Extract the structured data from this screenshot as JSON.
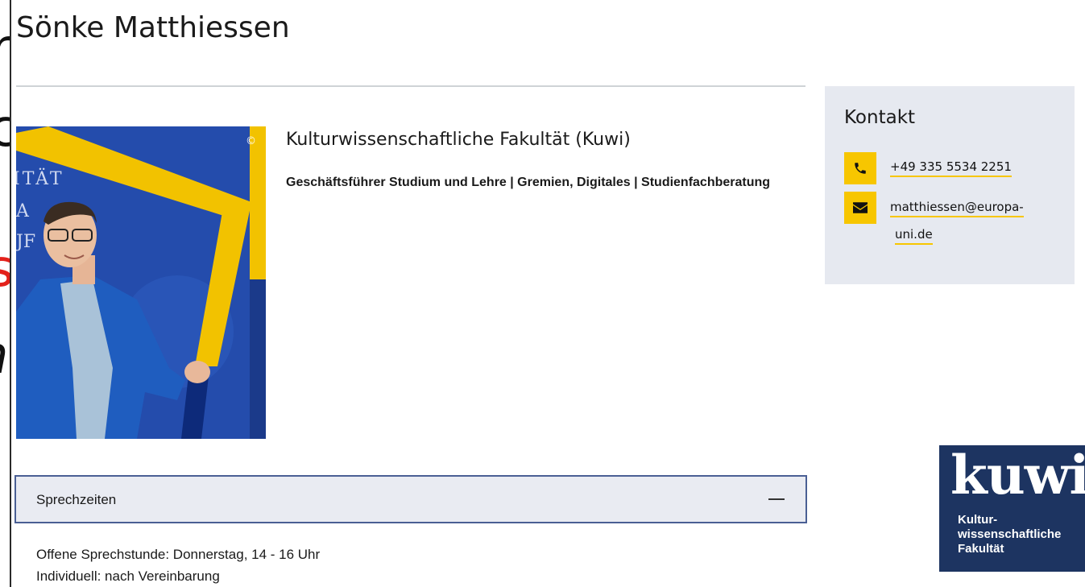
{
  "person": {
    "name": "Sönke Matthiessen",
    "faculty": "Kulturwissenschaftliche Fakultät (Kuwi)",
    "role": "Geschäftsführer Studium und Lehre | Gremien, Digitales | Studienfachberatung"
  },
  "photo": {
    "copyright": "©",
    "banner_lines": [
      "ITÄT",
      "A",
      "JF"
    ]
  },
  "contact": {
    "title": "Kontakt",
    "phone": "+49 335 5534 2251",
    "email_line1": "matthiessen@europa-",
    "email_line2": "uni.de",
    "phone_icon": "phone-icon",
    "email_icon": "envelope-icon"
  },
  "office_hours": {
    "title": "Sprechzeiten",
    "lines": [
      "Offene Sprechstunde: Donnerstag, 14 - 16 Uhr",
      "Individuell: nach Vereinbarung"
    ]
  },
  "logo": {
    "word": "kuwi",
    "lines": [
      "Kultur-",
      "wissenschaftliche",
      "Fakultät"
    ]
  },
  "colors": {
    "accent_yellow": "#f7c600",
    "panel_bg": "#e6e9f0",
    "accordion_border": "#4a5f94",
    "logo_bg": "#1d3461"
  }
}
